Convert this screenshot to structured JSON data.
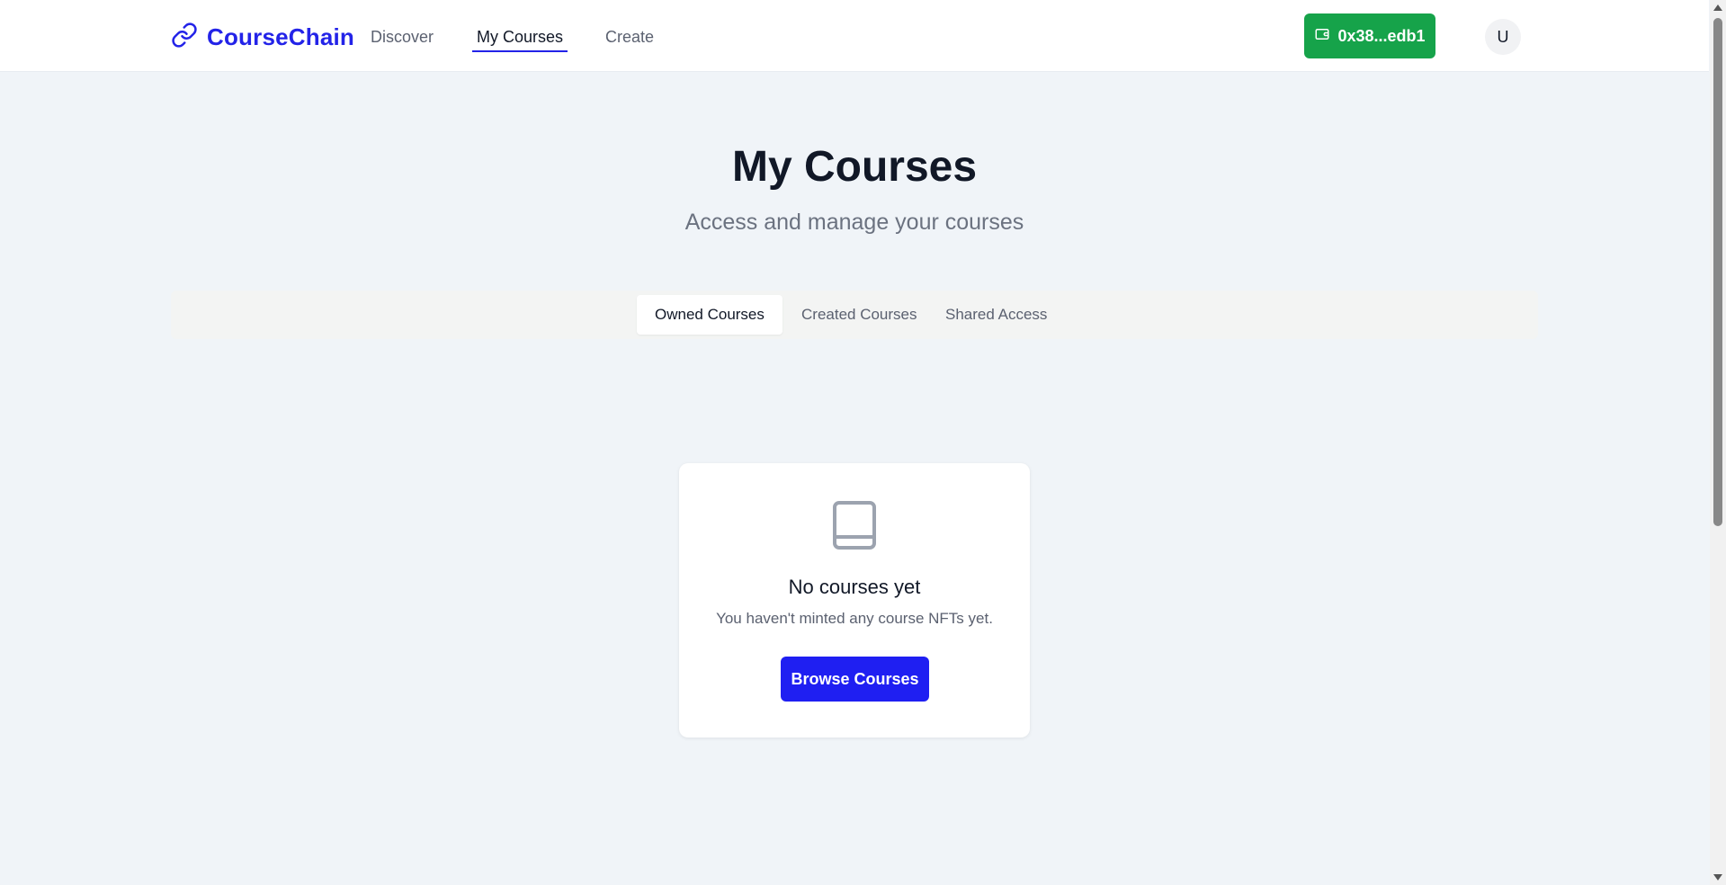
{
  "header": {
    "logo_text": "CourseChain",
    "nav": [
      {
        "label": "Discover",
        "active": false
      },
      {
        "label": "My Courses",
        "active": true
      },
      {
        "label": "Create",
        "active": false
      }
    ],
    "wallet_label": "0x38...edb1",
    "avatar_initial": "U"
  },
  "main": {
    "title": "My Courses",
    "subtitle": "Access and manage your courses",
    "tabs": [
      {
        "label": "Owned Courses",
        "active": true
      },
      {
        "label": "Created Courses",
        "active": false
      },
      {
        "label": "Shared Access",
        "active": false
      }
    ],
    "empty_state": {
      "icon": "book-icon",
      "title": "No courses yet",
      "description": "You haven't minted any course NFTs yet.",
      "button_label": "Browse Courses"
    }
  },
  "colors": {
    "brand": "#2323e8",
    "wallet_green": "#16a34a",
    "button_blue": "#1f1ff2",
    "background": "#f0f4f8"
  }
}
